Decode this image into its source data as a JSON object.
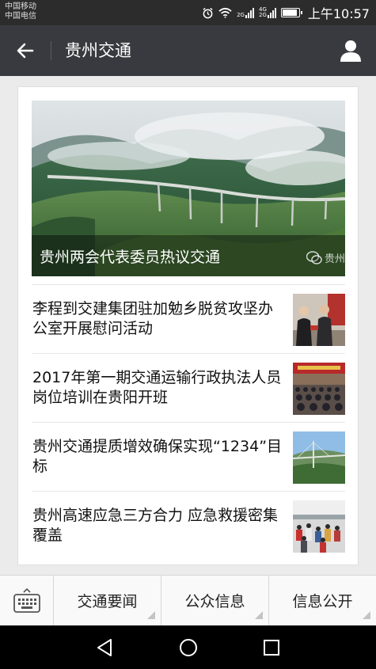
{
  "status_bar": {
    "carrier_1": "中国移动",
    "carrier_2": "中国电信",
    "net_1": "2G",
    "net_2a": "4G",
    "net_2b": "2G",
    "time": "上午10:57"
  },
  "header": {
    "title": "贵州交通",
    "back_icon": "arrow-left-icon",
    "profile_icon": "person-icon"
  },
  "featured": {
    "title": "贵州两会代表委员热议交通",
    "watermark": "贵州"
  },
  "news": [
    {
      "title": "李程到交建集团驻加勉乡脱贫攻坚办公室开展慰问活动",
      "thumb": "handshake-photo"
    },
    {
      "title": "2017年第一期交通运输行政执法人员岗位培训在贵阳开班",
      "thumb": "meeting-hall-photo"
    },
    {
      "title": "贵州交通提质增效确保实现“1234”目标",
      "thumb": "bridge-photo"
    },
    {
      "title": "贵州高速应急三方合力  应急救援密集覆盖",
      "thumb": "crowd-photo"
    }
  ],
  "menu": {
    "keyboard_icon": "keyboard-icon",
    "items": [
      {
        "label": "交通要闻"
      },
      {
        "label": "公众信息"
      },
      {
        "label": "信息公开"
      }
    ]
  },
  "colors": {
    "status_bar": "#2c2c2c",
    "title_bar": "#393a3f",
    "background": "#ebebeb"
  }
}
